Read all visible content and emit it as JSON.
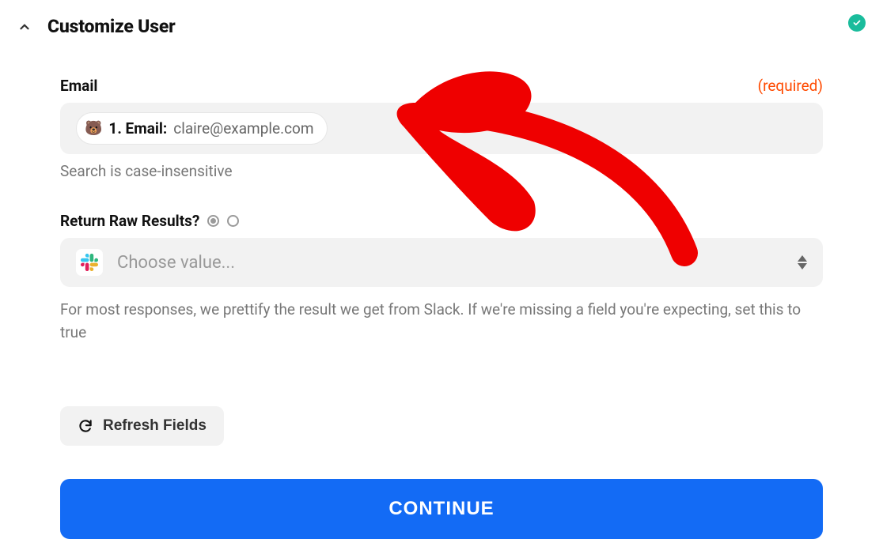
{
  "header": {
    "title": "Customize User"
  },
  "email": {
    "label": "Email",
    "required_text": "(required)",
    "pill_label": "1. Email:",
    "pill_value": "claire@example.com",
    "hint": "Search is case-insensitive"
  },
  "raw": {
    "label": "Return Raw Results?",
    "placeholder": "Choose value...",
    "description": "For most responses, we prettify the result we get from Slack. If we're missing a field you're expecting, set this to true"
  },
  "buttons": {
    "refresh": "Refresh Fields",
    "continue": "CONTINUE"
  }
}
